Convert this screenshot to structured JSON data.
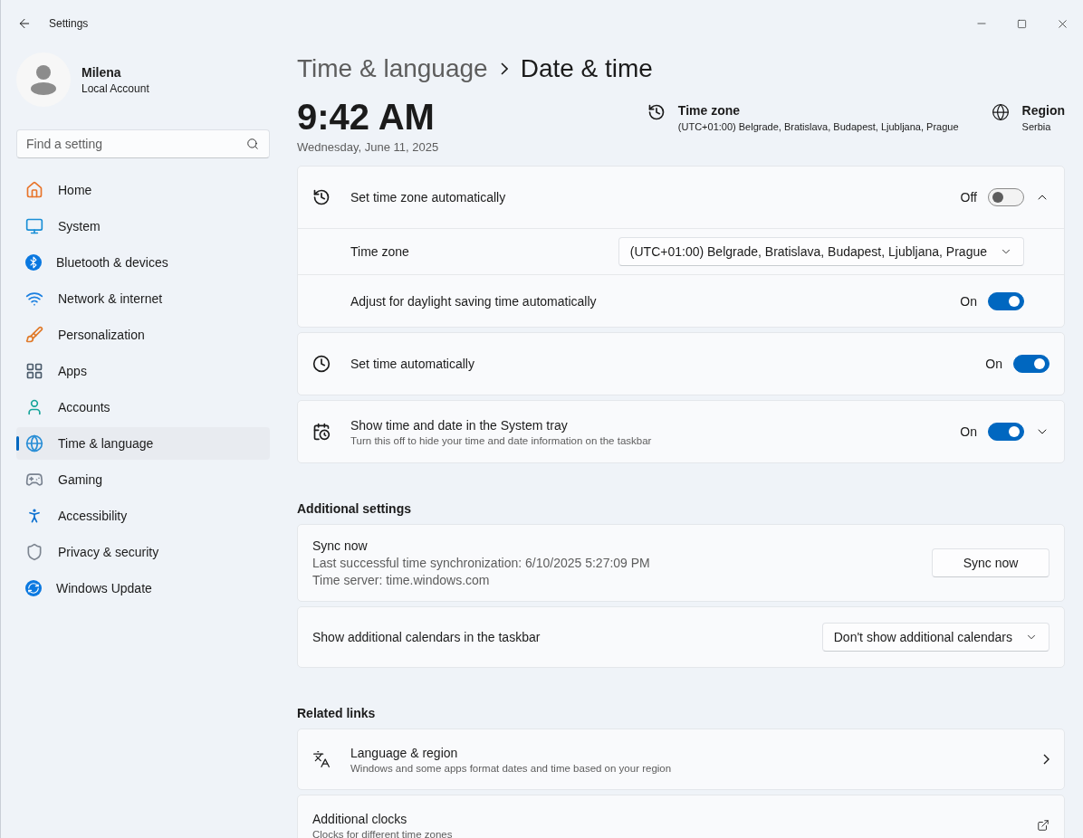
{
  "window": {
    "title": "Settings"
  },
  "user": {
    "name": "Milena",
    "account": "Local Account"
  },
  "search": {
    "placeholder": "Find a setting"
  },
  "sidebar": {
    "items": [
      {
        "label": "Home",
        "selected": false
      },
      {
        "label": "System",
        "selected": false
      },
      {
        "label": "Bluetooth & devices",
        "selected": false
      },
      {
        "label": "Network & internet",
        "selected": false
      },
      {
        "label": "Personalization",
        "selected": false
      },
      {
        "label": "Apps",
        "selected": false
      },
      {
        "label": "Accounts",
        "selected": false
      },
      {
        "label": "Time & language",
        "selected": true
      },
      {
        "label": "Gaming",
        "selected": false
      },
      {
        "label": "Accessibility",
        "selected": false
      },
      {
        "label": "Privacy & security",
        "selected": false
      },
      {
        "label": "Windows Update",
        "selected": false
      }
    ]
  },
  "breadcrumb": {
    "parent": "Time & language",
    "current": "Date & time"
  },
  "clock": {
    "time": "9:42 AM",
    "date": "Wednesday, June 11, 2025"
  },
  "info": [
    {
      "title": "Time zone",
      "value": "(UTC+01:00) Belgrade, Bratislava, Budapest, Ljubljana, Prague"
    },
    {
      "title": "Region",
      "value": "Serbia"
    }
  ],
  "cards": [
    {
      "title": "Set time zone automatically",
      "toggle": {
        "label": "Off",
        "on": false
      },
      "expanded": true,
      "children": [
        {
          "kind": "dropdown",
          "title": "Time zone",
          "value": "(UTC+01:00) Belgrade, Bratislava, Budapest, Ljubljana, Prague"
        },
        {
          "kind": "toggle",
          "title": "Adjust for daylight saving time automatically",
          "toggle": {
            "label": "On",
            "on": true
          }
        }
      ]
    },
    {
      "title": "Set time automatically",
      "toggle": {
        "label": "On",
        "on": true
      }
    },
    {
      "title": "Show time and date in the System tray",
      "description": "Turn this off to hide your time and date information on the taskbar",
      "toggle": {
        "label": "On",
        "on": true
      },
      "expanded": false
    }
  ],
  "sections": [
    {
      "heading": "Additional settings",
      "rows": [
        {
          "kind": "button",
          "title": "Sync now",
          "lines": [
            "Last successful time synchronization: 6/10/2025 5:27:09 PM",
            "Time server: time.windows.com"
          ],
          "button": "Sync now"
        },
        {
          "kind": "dropdown",
          "title": "Show additional calendars in the taskbar",
          "value": "Don't show additional calendars"
        }
      ]
    },
    {
      "heading": "Related links",
      "rows": [
        {
          "kind": "link",
          "title": "Language & region",
          "description": "Windows and some apps format dates and time based on your region",
          "external": false
        },
        {
          "kind": "link",
          "title": "Additional clocks",
          "description": "Clocks for different time zones",
          "external": true
        }
      ]
    }
  ]
}
